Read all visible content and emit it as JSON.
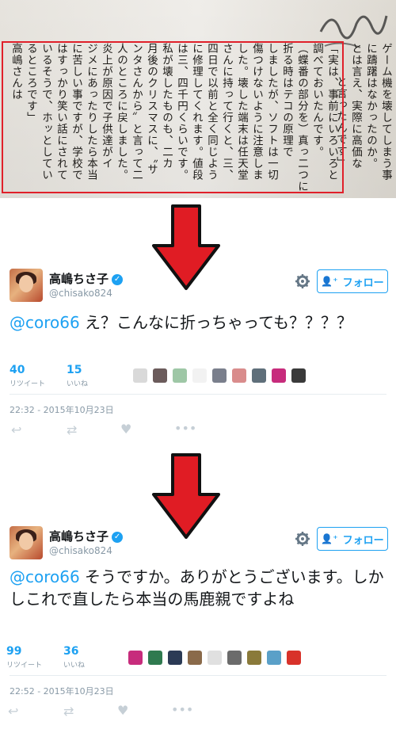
{
  "book": {
    "columns": [
      "「実は、事前にいろいろと",
      "調べておいたんです。",
      "（蝶番の部分を）真っ二つに",
      "折る時はテコの原理で",
      "しましたが、ソフトは一切",
      "傷つけないように注意しま",
      "した。壊した端末は任天堂",
      "さんに持って行くと、三、",
      "四日で以前と全く同じよう",
      "に修理してくれます。値段",
      "は三、四千円くらいです。",
      "私が壊したものも、二カ",
      "月後のクリスマスに、〝サ",
      "ンタさんから〟と言って二",
      "人のところに戻しました。",
      "炎上が原因で子供達がイ",
      "ジメにあったりしたら本当",
      "に苦しい事ですが、学校で",
      "はすっかり笑い話にされて",
      "いるそうで、ホッとしてい",
      "るところです」",
      "高嶋さんは"
    ],
    "outside_columns": [
      "ゲーム機を壊してしまう事",
      "に躊躇はなかったのか。",
      "とは言え、実際に高価な",
      "と言ったんです」"
    ]
  },
  "tweets": [
    {
      "name": "高嶋ちさ子",
      "handle": "@chisako824",
      "follow_label": "フォロー",
      "mention": "@coro66",
      "text": " え？こんなに折っちゃっても？？？？",
      "retweets": "40",
      "retweets_label": "リツイート",
      "likes": "15",
      "likes_label": "いいね",
      "timestamp": "22:32 - 2015年10月23日",
      "faces": [
        "#d9d9d9",
        "#6b5b5b",
        "#9ec7a6",
        "#f2f2f2",
        "#7a7f8c",
        "#d98c8c",
        "#5f6f7a",
        "#c72c7c",
        "#3a3a3a"
      ]
    },
    {
      "name": "高嶋ちさ子",
      "handle": "@chisako824",
      "follow_label": "フォロー",
      "mention": "@coro66",
      "text": " そうですか。ありがとうございます。しかしこれで直したら本当の馬鹿親ですよね",
      "retweets": "99",
      "retweets_label": "リツイート",
      "likes": "36",
      "likes_label": "いいね",
      "timestamp": "22:52 - 2015年10月23日",
      "faces": [
        "#c72c7c",
        "#2f7a4f",
        "#2b3a55",
        "#8a6a4a",
        "#e0e0e0",
        "#6b6b6b",
        "#8a7a3a",
        "#5aa0c8",
        "#d8322a"
      ]
    }
  ],
  "colors": {
    "accent": "#1da1f2",
    "highlight_box": "#e0202a",
    "arrow": "#e01c24"
  }
}
